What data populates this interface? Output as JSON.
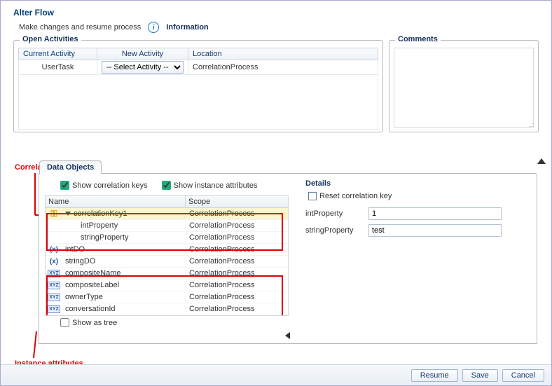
{
  "title": "Alter Flow",
  "subtitle": "Make changes and resume process",
  "info_label": "Information",
  "open_activities": {
    "legend": "Open Activities",
    "headers": {
      "current": "Current Activity",
      "new": "New Activity",
      "location": "Location"
    },
    "row": {
      "current": "UserTask",
      "new_placeholder": "-- Select Activity --",
      "location": "CorrelationProcess"
    }
  },
  "comments": {
    "legend": "Comments",
    "value": ""
  },
  "annotations": {
    "correlation_key": "Correlation key",
    "instance_attributes": "Instance attributes"
  },
  "data_objects": {
    "tab_label": "Data Objects",
    "show_correlation": "Show correlation keys",
    "show_instance": "Show instance attributes",
    "headers": {
      "name": "Name",
      "scope": "Scope"
    },
    "rows": [
      {
        "icon": "key",
        "name": "correlationKey1",
        "scope": "CorrelationProcess",
        "indent": 0,
        "expander": true
      },
      {
        "icon": "",
        "name": "intProperty",
        "scope": "CorrelationProcess",
        "indent": 1
      },
      {
        "icon": "",
        "name": "stringProperty",
        "scope": "CorrelationProcess",
        "indent": 1
      },
      {
        "icon": "xparen",
        "name": "intDO",
        "scope": "CorrelationProcess",
        "indent": 0
      },
      {
        "icon": "xparen",
        "name": "stringDO",
        "scope": "CorrelationProcess",
        "indent": 0
      },
      {
        "icon": "xyz",
        "name": "compositeName",
        "scope": "CorrelationProcess",
        "indent": 0
      },
      {
        "icon": "xyz",
        "name": "compositeLabel",
        "scope": "CorrelationProcess",
        "indent": 0
      },
      {
        "icon": "xyz",
        "name": "ownerType",
        "scope": "CorrelationProcess",
        "indent": 0
      },
      {
        "icon": "xyz",
        "name": "conversationId",
        "scope": "CorrelationProcess",
        "indent": 0
      }
    ],
    "show_as_tree": "Show as tree"
  },
  "details": {
    "heading": "Details",
    "reset_label": "Reset correlation key",
    "fields": [
      {
        "label": "intProperty",
        "value": "1"
      },
      {
        "label": "stringProperty",
        "value": "test"
      }
    ]
  },
  "buttons": {
    "resume": "Resume",
    "save": "Save",
    "cancel": "Cancel"
  }
}
